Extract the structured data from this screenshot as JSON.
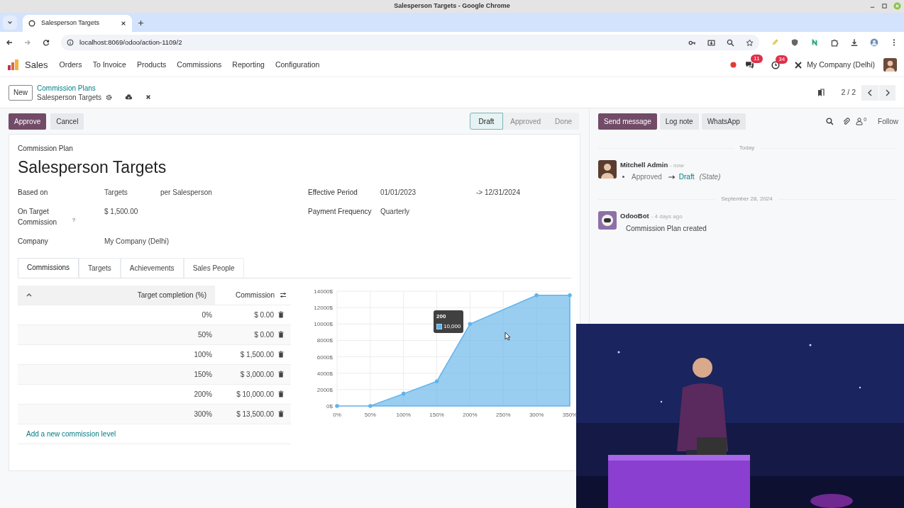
{
  "window": {
    "title": "Salesperson Targets - Google Chrome"
  },
  "browser": {
    "tabs": [
      {
        "label": "Salesperson Targets",
        "selected": true
      }
    ],
    "url": "localhost:8069/odoo/action-1109/2"
  },
  "app_nav": {
    "app": "Sales",
    "menu": [
      "Orders",
      "To Invoice",
      "Products",
      "Commissions",
      "Reporting",
      "Configuration"
    ],
    "messages_badge": "11",
    "activities_badge": "34",
    "company": "My Company (Delhi)"
  },
  "breadcrumb": {
    "new_button": "New",
    "parent": "Commission Plans",
    "current": "Salesperson Targets",
    "pager": "2 / 2"
  },
  "actions": {
    "buttons": [
      {
        "label": "Approve",
        "kind": "primary"
      },
      {
        "label": "Cancel",
        "kind": "secondary"
      }
    ],
    "stages": [
      {
        "label": "Draft",
        "selected": true
      },
      {
        "label": "Approved",
        "selected": false
      },
      {
        "label": "Done",
        "selected": false
      }
    ]
  },
  "form": {
    "caption": "Commission Plan",
    "title": "Salesperson Targets",
    "fields_left": [
      {
        "label": "Based on",
        "values": [
          "Targets",
          "per Salesperson"
        ]
      },
      {
        "label": "On Target Commission",
        "help": "?",
        "values": [
          "$ 1,500.00"
        ]
      },
      {
        "label": "Company",
        "values": [
          "My Company (Delhi)"
        ]
      }
    ],
    "fields_right": [
      {
        "label": "Effective Period",
        "values": [
          "01/01/2023",
          "-> 12/31/2024"
        ]
      },
      {
        "label": "Payment Frequency",
        "values": [
          "Quarterly"
        ]
      }
    ]
  },
  "notebook": {
    "tabs": [
      {
        "label": "Commissions",
        "selected": true
      },
      {
        "label": "Targets",
        "selected": false
      },
      {
        "label": "Achievements",
        "selected": false
      },
      {
        "label": "Sales People",
        "selected": false
      }
    ],
    "table": {
      "columns": [
        "Target completion (%)",
        "Commission"
      ],
      "rows": [
        {
          "target": "0%",
          "commission": "$ 0.00"
        },
        {
          "target": "50%",
          "commission": "$ 0.00"
        },
        {
          "target": "100%",
          "commission": "$ 1,500.00"
        },
        {
          "target": "150%",
          "commission": "$ 3,000.00"
        },
        {
          "target": "200%",
          "commission": "$ 10,000.00"
        },
        {
          "target": "300%",
          "commission": "$ 13,500.00"
        }
      ],
      "add_line": "Add a new commission level"
    },
    "chart_data": {
      "type": "area",
      "x": [
        0,
        50,
        100,
        150,
        200,
        300,
        350
      ],
      "series": [
        {
          "color": "#62b3ea",
          "values": [
            0,
            0,
            1500,
            3000,
            10000,
            13500,
            13500
          ]
        }
      ],
      "xlim": [
        0,
        350
      ],
      "ylim": [
        0,
        14000
      ],
      "grid": true,
      "xticks": [
        {
          "value": 0,
          "label": "0%"
        },
        {
          "value": 50,
          "label": "50%"
        },
        {
          "value": 100,
          "label": "100%"
        },
        {
          "value": 150,
          "label": "150%"
        },
        {
          "value": 200,
          "label": "200%"
        },
        {
          "value": 250,
          "label": "250%"
        },
        {
          "value": 300,
          "label": "300%"
        },
        {
          "value": 350,
          "label": "350%"
        }
      ],
      "yticks": [
        {
          "value": 0,
          "label": "0$"
        },
        {
          "value": 2000,
          "label": "2000$"
        },
        {
          "value": 4000,
          "label": "4000$"
        },
        {
          "value": 6000,
          "label": "6000$"
        },
        {
          "value": 8000,
          "label": "8000$"
        },
        {
          "value": 10000,
          "label": "10000$"
        },
        {
          "value": 12000,
          "label": "12000$"
        },
        {
          "value": 14000,
          "label": "14000$"
        }
      ]
    },
    "tooltip": {
      "title": "200",
      "value": "10,000"
    }
  },
  "chatter": {
    "buttons": [
      {
        "label": "Send message",
        "kind": "primary"
      },
      {
        "label": "Log note",
        "kind": "secondary"
      },
      {
        "label": "WhatsApp",
        "kind": "secondary"
      }
    ],
    "followers_count": "0",
    "follow": "Follow",
    "groups": [
      {
        "date": "Today",
        "messages": [
          {
            "author": "Mitchell Admin",
            "time": "- now",
            "kind": "tracking",
            "old": "Approved",
            "new": "Draft",
            "field": "(State)",
            "avatar": {
              "kind": "person"
            }
          }
        ]
      },
      {
        "date": "September 28, 2024",
        "messages": [
          {
            "author": "OdooBot",
            "time": "- 4 days ago",
            "kind": "text",
            "body": "Commission Plan created",
            "avatar": {
              "kind": "bot"
            }
          }
        ]
      }
    ]
  }
}
